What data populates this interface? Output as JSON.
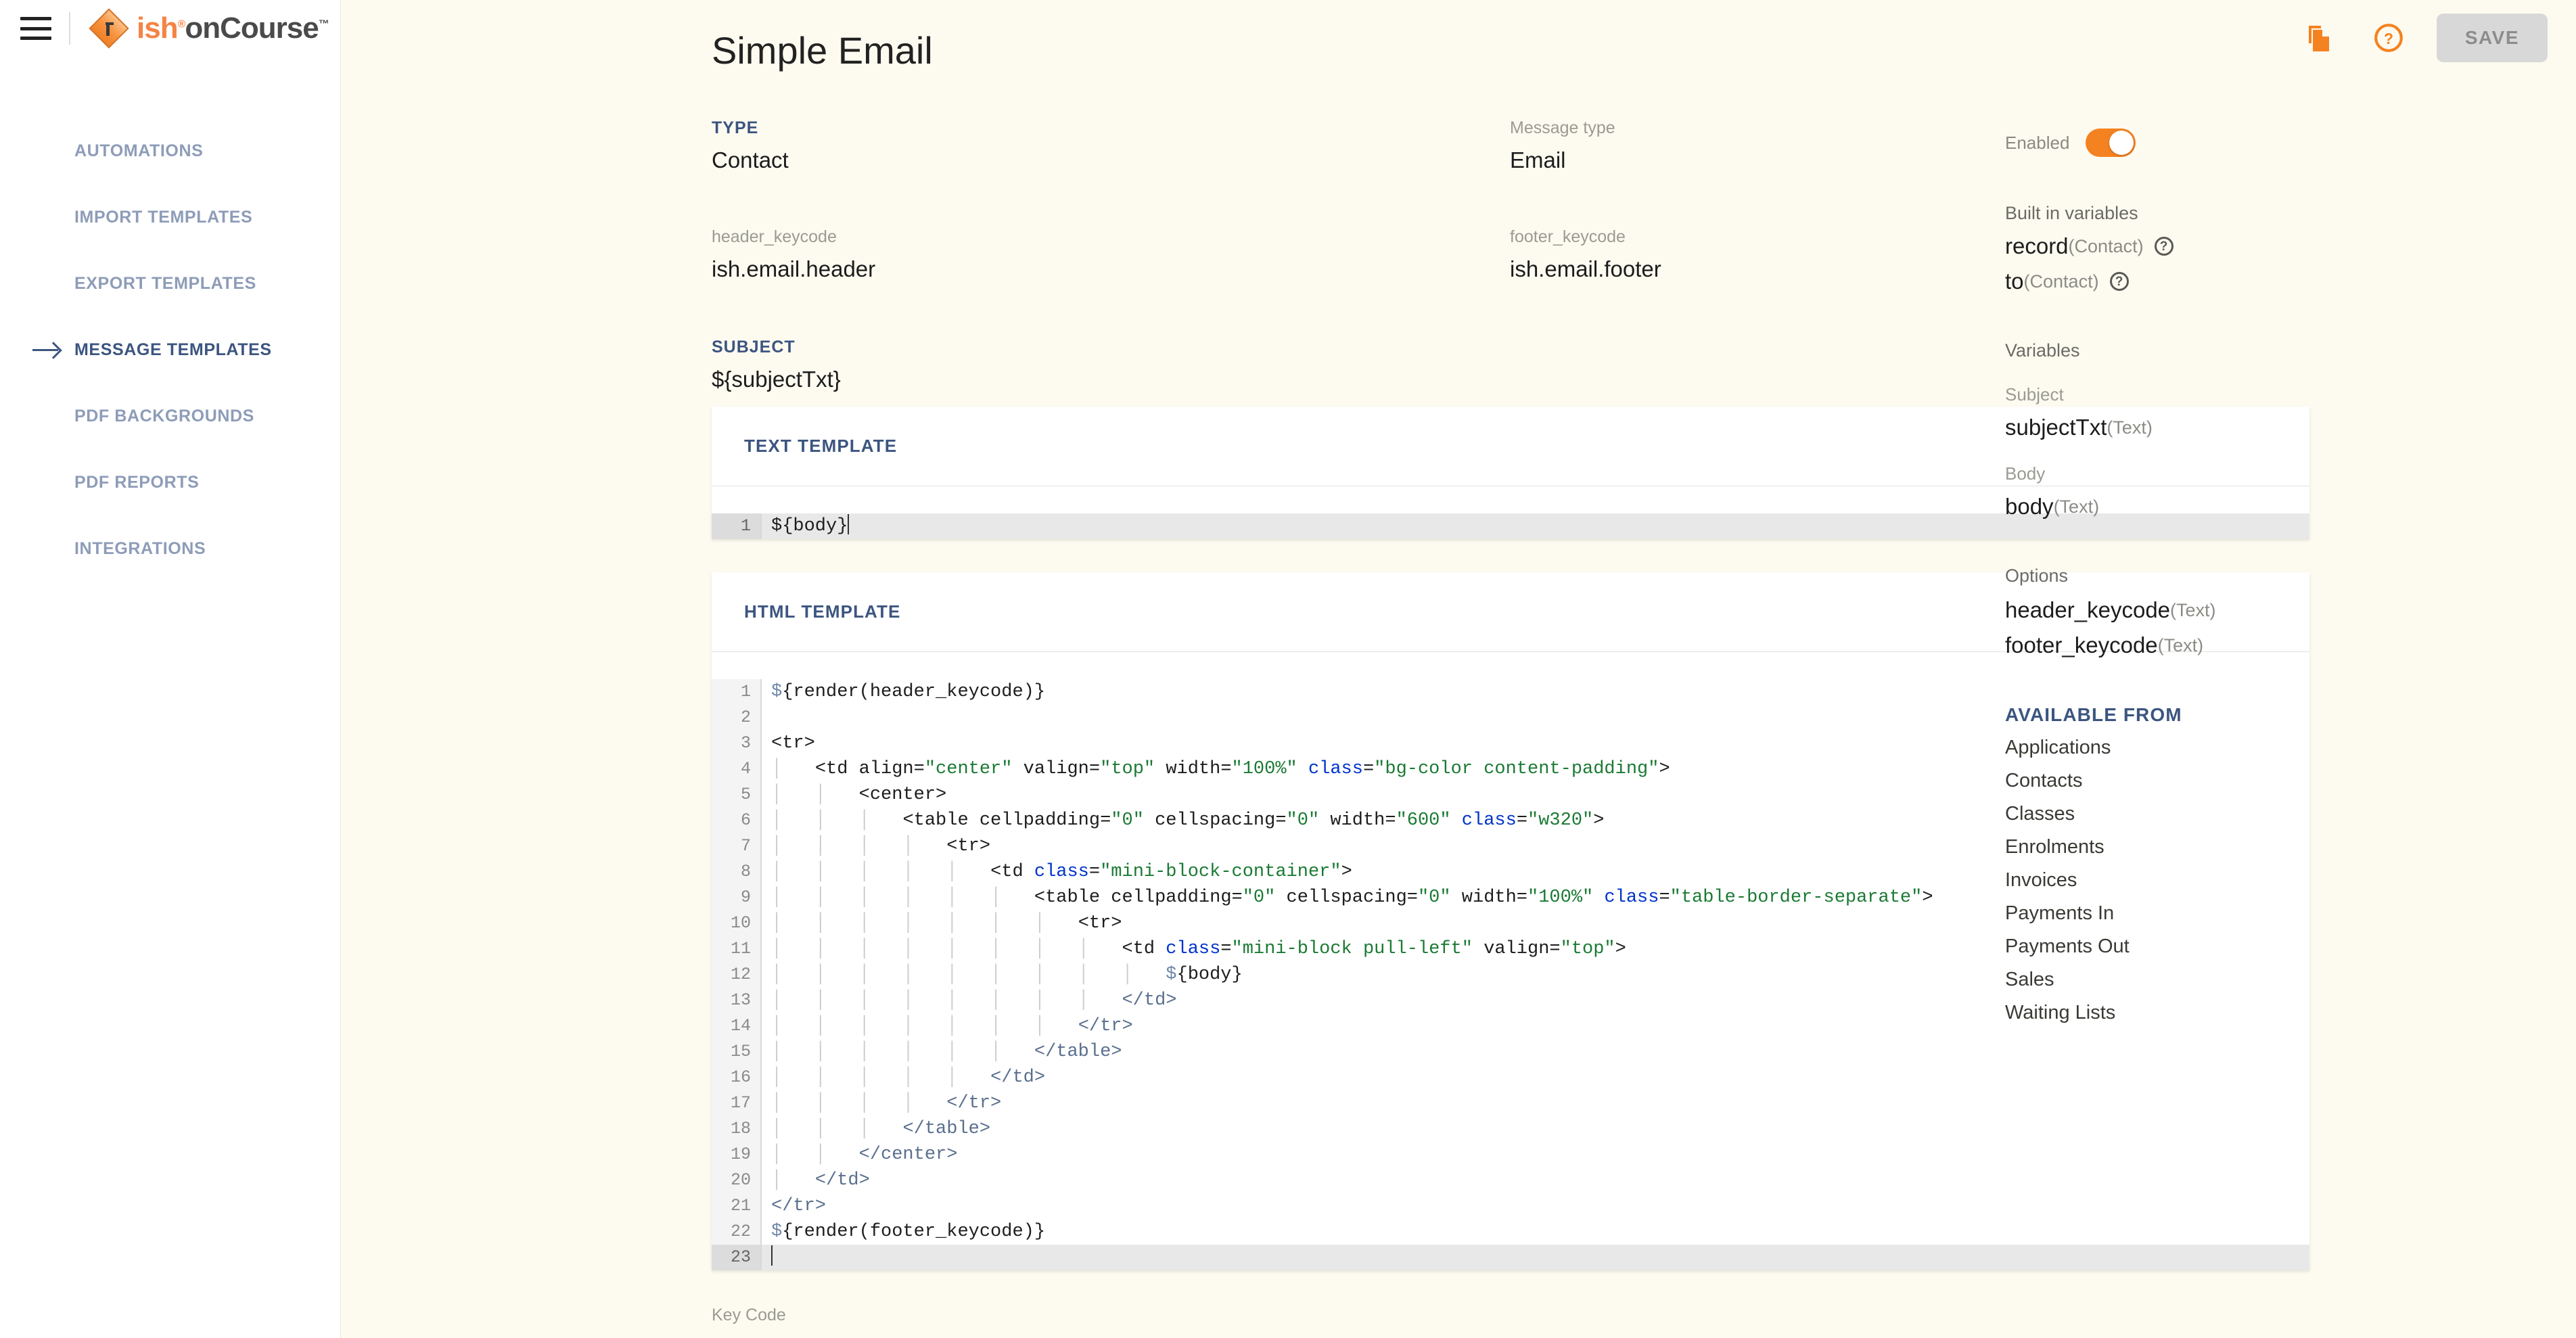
{
  "brand": {
    "name_primary": "ish",
    "name_secondary": "onCourse",
    "reg_mark": "®",
    "tm_mark": "™"
  },
  "sidebar": {
    "items": [
      {
        "label": "AUTOMATIONS",
        "active": false
      },
      {
        "label": "IMPORT TEMPLATES",
        "active": false
      },
      {
        "label": "EXPORT TEMPLATES",
        "active": false
      },
      {
        "label": "MESSAGE TEMPLATES",
        "active": true
      },
      {
        "label": "PDF BACKGROUNDS",
        "active": false
      },
      {
        "label": "PDF REPORTS",
        "active": false
      },
      {
        "label": "INTEGRATIONS",
        "active": false
      }
    ]
  },
  "topbar": {
    "duplicate_icon": "copy-icon",
    "help_icon": "help-circle-icon",
    "save_label": "SAVE"
  },
  "page": {
    "title": "Simple Email"
  },
  "fields": {
    "type_label": "TYPE",
    "type_value": "Contact",
    "message_type_label": "Message type",
    "message_type_value": "Email",
    "header_keycode_label": "header_keycode",
    "header_keycode_value": "ish.email.header",
    "footer_keycode_label": "footer_keycode",
    "footer_keycode_value": "ish.email.footer",
    "subject_label": "SUBJECT",
    "subject_value": "${subjectTxt}"
  },
  "text_template": {
    "title": "TEXT TEMPLATE",
    "lines": [
      {
        "n": "1",
        "text": "${body}",
        "active": true
      }
    ]
  },
  "html_template": {
    "title": "HTML TEMPLATE",
    "lines": [
      {
        "n": "1",
        "text": "${render(header_keycode)}"
      },
      {
        "n": "2",
        "text": ""
      },
      {
        "n": "3",
        "text": "<tr>"
      },
      {
        "n": "4",
        "text": "    <td align=\"center\" valign=\"top\" width=\"100%\" class=\"bg-color content-padding\">"
      },
      {
        "n": "5",
        "text": "        <center>"
      },
      {
        "n": "6",
        "text": "            <table cellpadding=\"0\" cellspacing=\"0\" width=\"600\" class=\"w320\">"
      },
      {
        "n": "7",
        "text": "                <tr>"
      },
      {
        "n": "8",
        "text": "                    <td class=\"mini-block-container\">"
      },
      {
        "n": "9",
        "text": "                        <table cellpadding=\"0\" cellspacing=\"0\" width=\"100%\" class=\"table-border-separate\">"
      },
      {
        "n": "10",
        "text": "                            <tr>"
      },
      {
        "n": "11",
        "text": "                                <td class=\"mini-block pull-left\" valign=\"top\">"
      },
      {
        "n": "12",
        "text": "                                    ${body}"
      },
      {
        "n": "13",
        "text": "                                </td>"
      },
      {
        "n": "14",
        "text": "                            </tr>"
      },
      {
        "n": "15",
        "text": "                        </table>"
      },
      {
        "n": "16",
        "text": "                    </td>"
      },
      {
        "n": "17",
        "text": "                </tr>"
      },
      {
        "n": "18",
        "text": "            </table>"
      },
      {
        "n": "19",
        "text": "        </center>"
      },
      {
        "n": "20",
        "text": "    </td>"
      },
      {
        "n": "21",
        "text": "</tr>"
      },
      {
        "n": "22",
        "text": "${render(footer_keycode)}"
      },
      {
        "n": "23",
        "text": "",
        "active": true
      }
    ]
  },
  "footer": {
    "key_code_label": "Key Code"
  },
  "right_panel": {
    "enabled_label": "Enabled",
    "enabled_state": "on",
    "built_in_variables_title": "Built in variables",
    "built_in_variables": [
      {
        "name": "record",
        "type": "(Contact)",
        "help": "?"
      },
      {
        "name": "to",
        "type": "(Contact)",
        "help": "?"
      }
    ],
    "variables_title": "Variables",
    "subject_sub_label": "Subject",
    "subject_variable": {
      "name": "subjectTxt",
      "type": "(Text)"
    },
    "body_sub_label": "Body",
    "body_variable": {
      "name": "body",
      "type": "(Text)"
    },
    "options_title": "Options",
    "options": [
      {
        "name": "header_keycode",
        "type": "(Text)"
      },
      {
        "name": "footer_keycode",
        "type": "(Text)"
      }
    ],
    "available_from_title": "AVAILABLE FROM",
    "available_from": [
      "Applications",
      "Contacts",
      "Classes",
      "Enrolments",
      "Invoices",
      "Payments In",
      "Payments Out",
      "Sales",
      "Waiting Lists"
    ]
  },
  "colors": {
    "page_bg": "#fdfbf0",
    "accent_orange": "#f58220",
    "accent_blue": "#3c5580",
    "nav_inactive": "#8d9cb8",
    "token_value": "#1b7a34",
    "token_class": "#0033cc",
    "token_close_tag": "#5a6f8e"
  }
}
